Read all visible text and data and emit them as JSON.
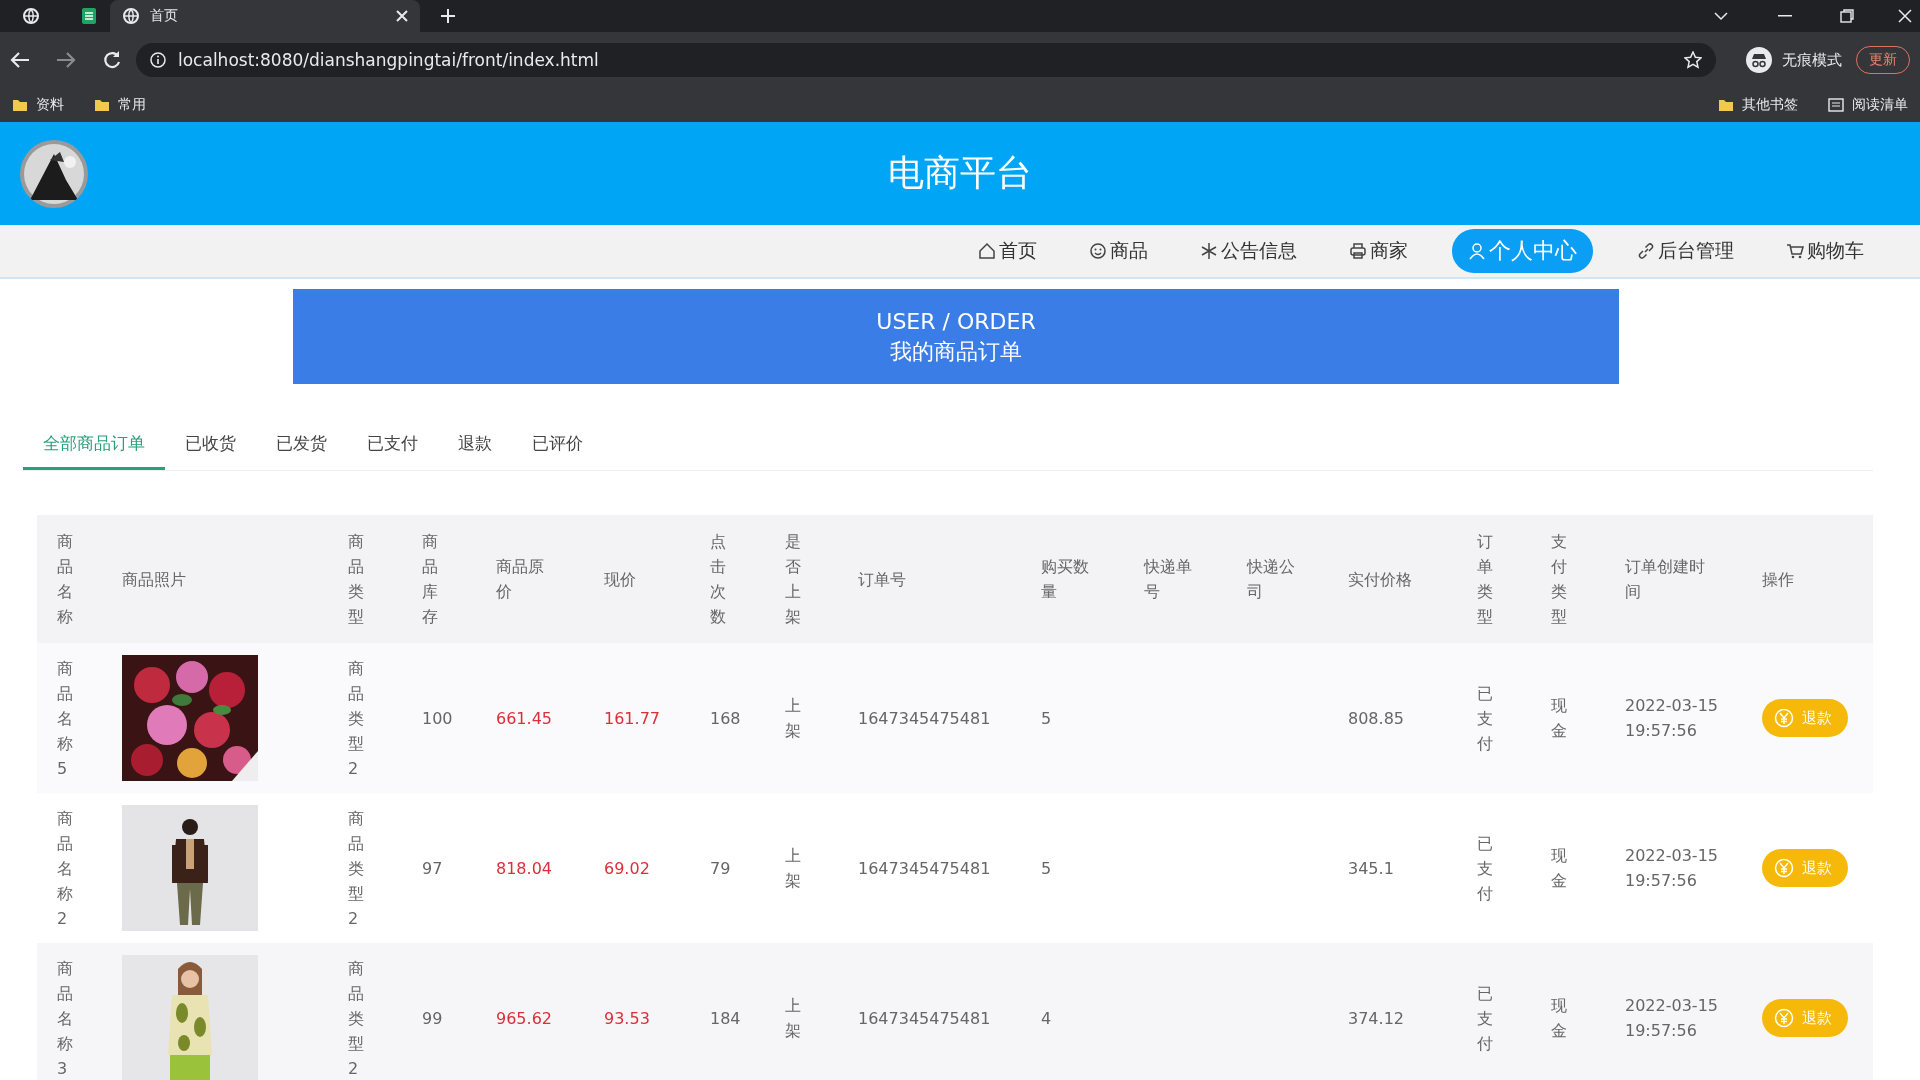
{
  "browser": {
    "tab_label": "首页",
    "address": "localhost:8080/dianshangpingtai/front/index.html",
    "profile_label": "无痕模式",
    "update_button": "更新",
    "bookmarks": [
      "资料",
      "常用"
    ],
    "bookmarks_right": [
      "其他书签",
      "阅读清单"
    ]
  },
  "header": {
    "title": "电商平台"
  },
  "nav": [
    {
      "label": "首页",
      "selected": false
    },
    {
      "label": "商品",
      "selected": false
    },
    {
      "label": "公告信息",
      "selected": false
    },
    {
      "label": "商家",
      "selected": false
    },
    {
      "label": "个人中心",
      "selected": true
    },
    {
      "label": "后台管理",
      "selected": false
    },
    {
      "label": "购物车",
      "selected": false
    }
  ],
  "banner": {
    "subtitle": "USER / ORDER",
    "title": "我的商品订单"
  },
  "order_tabs": [
    {
      "label": "全部商品订单",
      "selected": true
    },
    {
      "label": "已收货",
      "selected": false
    },
    {
      "label": "已发货",
      "selected": false
    },
    {
      "label": "已支付",
      "selected": false
    },
    {
      "label": "退款",
      "selected": false
    },
    {
      "label": "已评价",
      "selected": false
    }
  ],
  "table": {
    "columns": [
      "商品名称",
      "商品照片",
      "商品类型",
      "商品库存",
      "商品原价",
      "现价",
      "点击次数",
      "是否上架",
      "订单号",
      "购买数量",
      "快递单号",
      "快递公司",
      "实付价格",
      "订单类型",
      "支付类型",
      "订单创建时间",
      "操作"
    ],
    "rows": [
      {
        "name": "商品名称5",
        "type": "商品类型2",
        "stock": "100",
        "original_price": "661.45",
        "price": "161.77",
        "clicks": "168",
        "on_shelf": "上架",
        "order_no": "1647345475481",
        "quantity": "5",
        "paid": "808.85",
        "order_type": "已支付",
        "pay_type": "现金",
        "created": "2022-03-15 19:57:56",
        "action": "退款"
      },
      {
        "name": "商品名称2",
        "type": "商品类型2",
        "stock": "97",
        "original_price": "818.04",
        "price": "69.02",
        "clicks": "79",
        "on_shelf": "上架",
        "order_no": "1647345475481",
        "quantity": "5",
        "paid": "345.1",
        "order_type": "已支付",
        "pay_type": "现金",
        "created": "2022-03-15 19:57:56",
        "action": "退款"
      },
      {
        "name": "商品名称3",
        "type": "商品类型2",
        "stock": "99",
        "original_price": "965.62",
        "price": "93.53",
        "clicks": "184",
        "on_shelf": "上架",
        "order_no": "1647345475481",
        "quantity": "4",
        "paid": "374.12",
        "order_type": "已支付",
        "pay_type": "现金",
        "created": "2022-03-15 19:57:56",
        "action": "退款"
      }
    ]
  }
}
